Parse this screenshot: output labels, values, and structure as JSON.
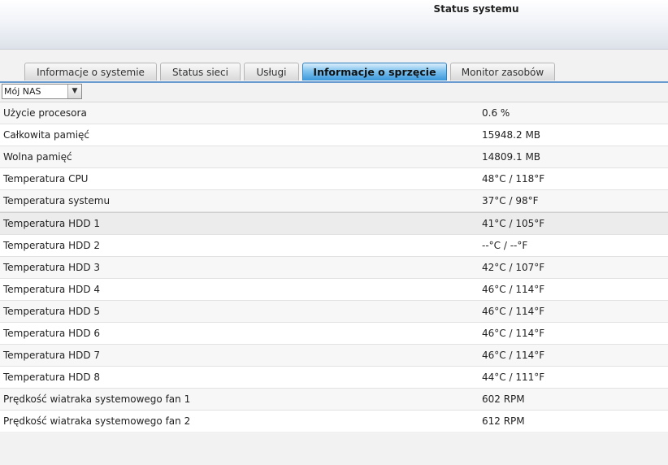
{
  "header": {
    "title": "Status systemu"
  },
  "tabs": [
    {
      "label": "Informacje o systemie",
      "active": false
    },
    {
      "label": "Status sieci",
      "active": false
    },
    {
      "label": "Usługi",
      "active": false
    },
    {
      "label": "Informacje o sprzęcie",
      "active": true
    },
    {
      "label": "Monitor zasobów",
      "active": false
    }
  ],
  "device_select": {
    "value": "Mój NAS"
  },
  "rows": [
    {
      "label": "Użycie procesora",
      "value": "0.6 %"
    },
    {
      "label": "Całkowita pamięć",
      "value": "15948.2 MB"
    },
    {
      "label": "Wolna pamięć",
      "value": "14809.1 MB"
    },
    {
      "label": "Temperatura CPU",
      "value": "48°C / 118°F"
    },
    {
      "label": "Temperatura systemu",
      "value": "37°C / 98°F"
    },
    {
      "label": "Temperatura HDD 1",
      "value": "41°C / 105°F"
    },
    {
      "label": "Temperatura HDD 2",
      "value": "--°C / --°F"
    },
    {
      "label": "Temperatura HDD 3",
      "value": "42°C / 107°F"
    },
    {
      "label": "Temperatura HDD 4",
      "value": "46°C / 114°F"
    },
    {
      "label": "Temperatura HDD 5",
      "value": "46°C / 114°F"
    },
    {
      "label": "Temperatura HDD 6",
      "value": "46°C / 114°F"
    },
    {
      "label": "Temperatura HDD 7",
      "value": "46°C / 114°F"
    },
    {
      "label": "Temperatura HDD 8",
      "value": "44°C / 111°F"
    },
    {
      "label": "Prędkość wiatraka systemowego fan 1",
      "value": "602 RPM"
    },
    {
      "label": "Prędkość wiatraka systemowego fan 2",
      "value": "612 RPM"
    }
  ],
  "colors": {
    "active_tab": "#3b98dc",
    "tab_underline": "#6a9bd0"
  }
}
